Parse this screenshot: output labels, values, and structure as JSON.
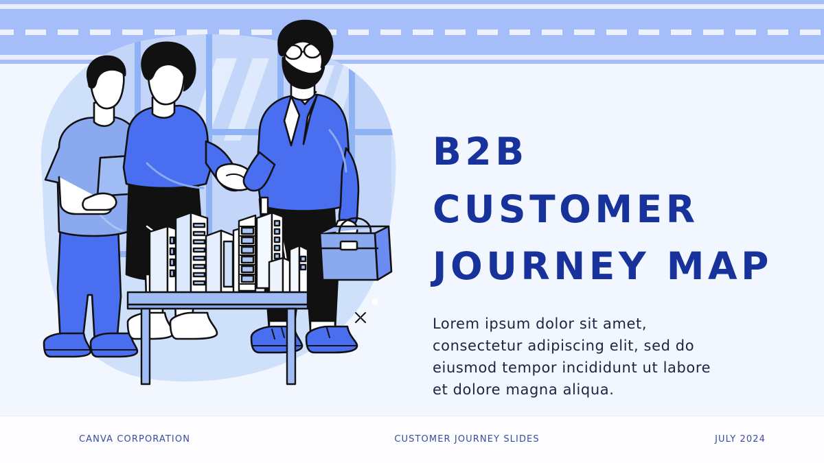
{
  "slide": {
    "title": "B2B Customer\nJourney Map",
    "body": "Lorem ipsum dolor sit amet, consectetur adipiscing elit, sed do eiusmod tempor incididunt ut labore et dolore magna aliqua."
  },
  "footer": {
    "left": "Canva Corporation",
    "center": "Customer Journey Slides",
    "right": "July 2024"
  },
  "colors": {
    "background": "#f2f6fe",
    "road": "#a5bdf9",
    "road_marking": "#eef2fd",
    "blob": "#cfe0fb",
    "title": "#17339b",
    "body_text": "#1d2440",
    "footer_text": "#3a4a9e",
    "accent_blue": "#4a6ef0",
    "light_blue": "#8aa9ee",
    "pale_blue": "#c3d6fa",
    "outline": "#111111",
    "white": "#ffffff"
  },
  "illustration": {
    "name": "business-handshake-illustration",
    "description": "Three people in an office beside a table holding a white and blue model city; two of them shake hands.",
    "elements": [
      "window-wall-background",
      "blob-backdrop",
      "person-left-holding-folder",
      "person-center-woman",
      "person-right-businessman-with-briefcase",
      "table-with-city-model",
      "sparkle-mark",
      "dot-mark"
    ]
  }
}
